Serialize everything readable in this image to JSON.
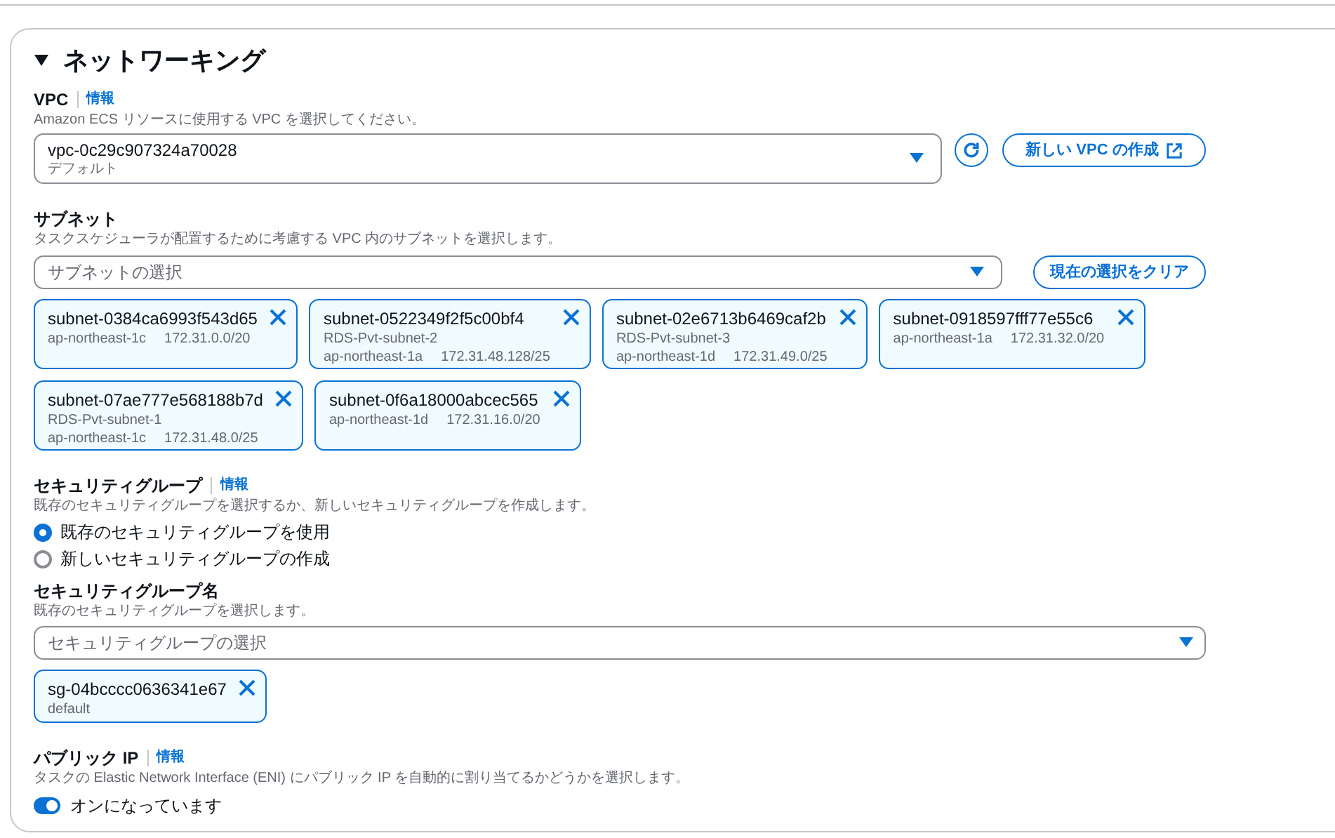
{
  "section": {
    "title": "ネットワーキング",
    "expanded": true
  },
  "vpc": {
    "label": "VPC",
    "info": "情報",
    "description": "Amazon ECS リソースに使用する VPC を選択してください。",
    "value": "vpc-0c29c907324a70028",
    "value_sub": "デフォルト",
    "create_button": "新しい VPC の作成"
  },
  "subnets": {
    "label": "サブネット",
    "description": "タスクスケジューラが配置するために考慮する VPC 内のサブネットを選択します。",
    "placeholder": "サブネットの選択",
    "clear_button": "現在の選択をクリア",
    "tokens": [
      {
        "id": "subnet-0384ca6993f543d65",
        "az": "ap-northeast-1c",
        "cidr": "172.31.0.0/20"
      },
      {
        "id": "subnet-0522349f2f5c00bf4",
        "name": "RDS-Pvt-subnet-2",
        "az": "ap-northeast-1a",
        "cidr": "172.31.48.128/25"
      },
      {
        "id": "subnet-02e6713b6469caf2b",
        "name": "RDS-Pvt-subnet-3",
        "az": "ap-northeast-1d",
        "cidr": "172.31.49.0/25"
      },
      {
        "id": "subnet-0918597fff77e55c6",
        "az": "ap-northeast-1a",
        "cidr": "172.31.32.0/20"
      },
      {
        "id": "subnet-07ae777e568188b7d",
        "name": "RDS-Pvt-subnet-1",
        "az": "ap-northeast-1c",
        "cidr": "172.31.48.0/25"
      },
      {
        "id": "subnet-0f6a18000abcec565",
        "az": "ap-northeast-1d",
        "cidr": "172.31.16.0/20"
      }
    ]
  },
  "security_group": {
    "label": "セキュリティグループ",
    "info": "情報",
    "description": "既存のセキュリティグループを選択するか、新しいセキュリティグループを作成します。",
    "options": [
      {
        "label": "既存のセキュリティグループを使用",
        "selected": true
      },
      {
        "label": "新しいセキュリティグループの作成",
        "selected": false
      }
    ]
  },
  "security_group_name": {
    "label": "セキュリティグループ名",
    "description": "既存のセキュリティグループを選択します。",
    "placeholder": "セキュリティグループの選択",
    "tokens": [
      {
        "id": "sg-04bcccc0636341e67",
        "name": "default"
      }
    ]
  },
  "public_ip": {
    "label": "パブリック IP",
    "info": "情報",
    "description": "タスクの Elastic Network Interface (ENI) にパブリック IP を自動的に割り当てるかどうかを選択します。",
    "toggle_label": "オンになっています",
    "on": true
  }
}
